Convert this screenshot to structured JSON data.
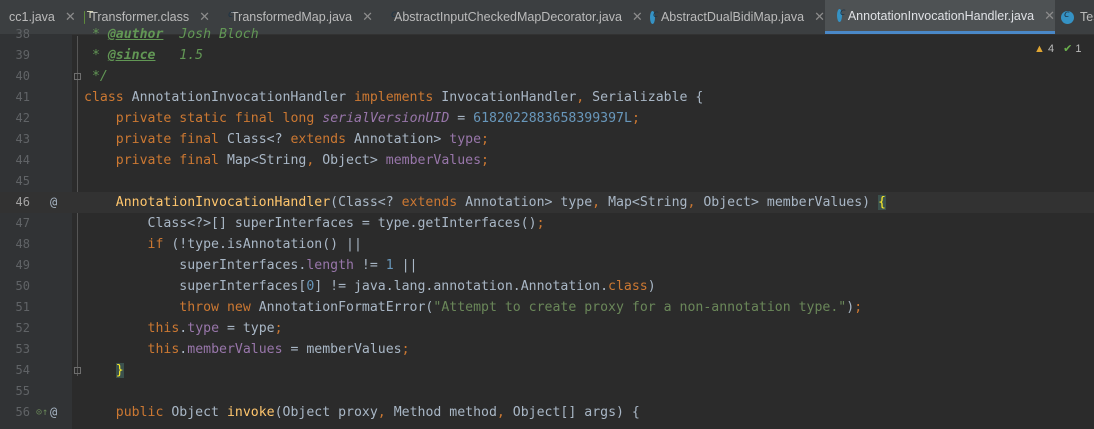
{
  "tabs": [
    {
      "label": "cc1.java",
      "icon": "java-class-icon"
    },
    {
      "label": "Transformer.class",
      "icon": "interface-icon"
    },
    {
      "label": "TransformedMap.java",
      "icon": "java-class-icon"
    },
    {
      "label": "AbstractInputCheckedMapDecorator.java",
      "icon": "java-class-icon"
    },
    {
      "label": "AbstractDualBidiMap.java",
      "icon": "java-class-icon"
    },
    {
      "label": "AnnotationInvocationHandler.java",
      "icon": "java-class-icon",
      "active": true
    },
    {
      "label": "Tes",
      "icon": "java-class-icon"
    }
  ],
  "inspection": {
    "warnings": "4",
    "checks": "1"
  },
  "current_line": "46",
  "lines": [
    {
      "n": "38",
      "text": " * @author  Josh Bloch"
    },
    {
      "n": "39",
      "text": " * @since   1.5"
    },
    {
      "n": "40",
      "text": " */"
    },
    {
      "n": "41",
      "text": "class AnnotationInvocationHandler implements InvocationHandler, Serializable {"
    },
    {
      "n": "42",
      "text": "    private static final long serialVersionUID = 6182022883658399397L;"
    },
    {
      "n": "43",
      "text": "    private final Class<? extends Annotation> type;"
    },
    {
      "n": "44",
      "text": "    private final Map<String, Object> memberValues;"
    },
    {
      "n": "45",
      "text": ""
    },
    {
      "n": "46",
      "text": "    AnnotationInvocationHandler(Class<? extends Annotation> type, Map<String, Object> memberValues) {"
    },
    {
      "n": "47",
      "text": "        Class<?>[] superInterfaces = type.getInterfaces();"
    },
    {
      "n": "48",
      "text": "        if (!type.isAnnotation() ||"
    },
    {
      "n": "49",
      "text": "            superInterfaces.length != 1 ||"
    },
    {
      "n": "50",
      "text": "            superInterfaces[0] != java.lang.annotation.Annotation.class)"
    },
    {
      "n": "51",
      "text": "            throw new AnnotationFormatError(\"Attempt to create proxy for a non-annotation type.\");"
    },
    {
      "n": "52",
      "text": "        this.type = type;"
    },
    {
      "n": "53",
      "text": "        this.memberValues = memberValues;"
    },
    {
      "n": "54",
      "text": "    }"
    },
    {
      "n": "55",
      "text": ""
    },
    {
      "n": "56",
      "text": "    public Object invoke(Object proxy, Method method, Object[] args) {"
    }
  ],
  "gutter_marks": {
    "46": "@",
    "56": "@"
  }
}
